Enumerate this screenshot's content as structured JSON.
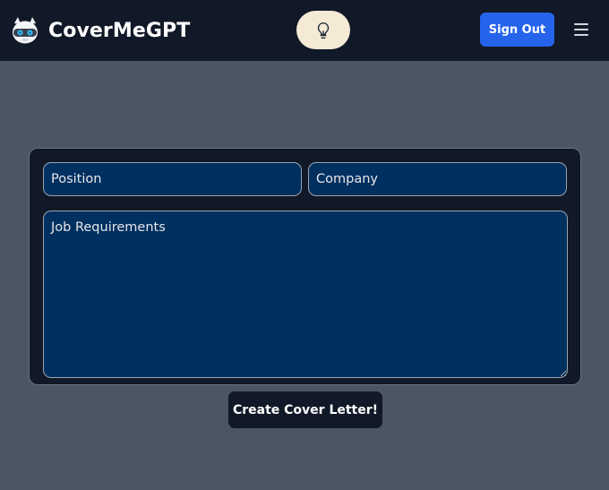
{
  "app": {
    "title": "CoverMeGPT"
  },
  "header": {
    "logo_icon": "robot-mascot-icon",
    "idea_icon": "lightbulb-icon",
    "sign_out_label": "Sign Out",
    "menu_icon": "hamburger-menu-icon"
  },
  "form": {
    "position_placeholder": "Position",
    "position_value": "",
    "company_placeholder": "Company",
    "company_value": "",
    "requirements_placeholder": "Job Requirements",
    "requirements_value": "",
    "submit_label": "Create Cover Letter!"
  },
  "colors": {
    "page_background": "#4b5563",
    "navbar": "#111827",
    "primary_button": "#2563eb",
    "input_background": "#003060",
    "idea_button": "#f5ead6"
  }
}
